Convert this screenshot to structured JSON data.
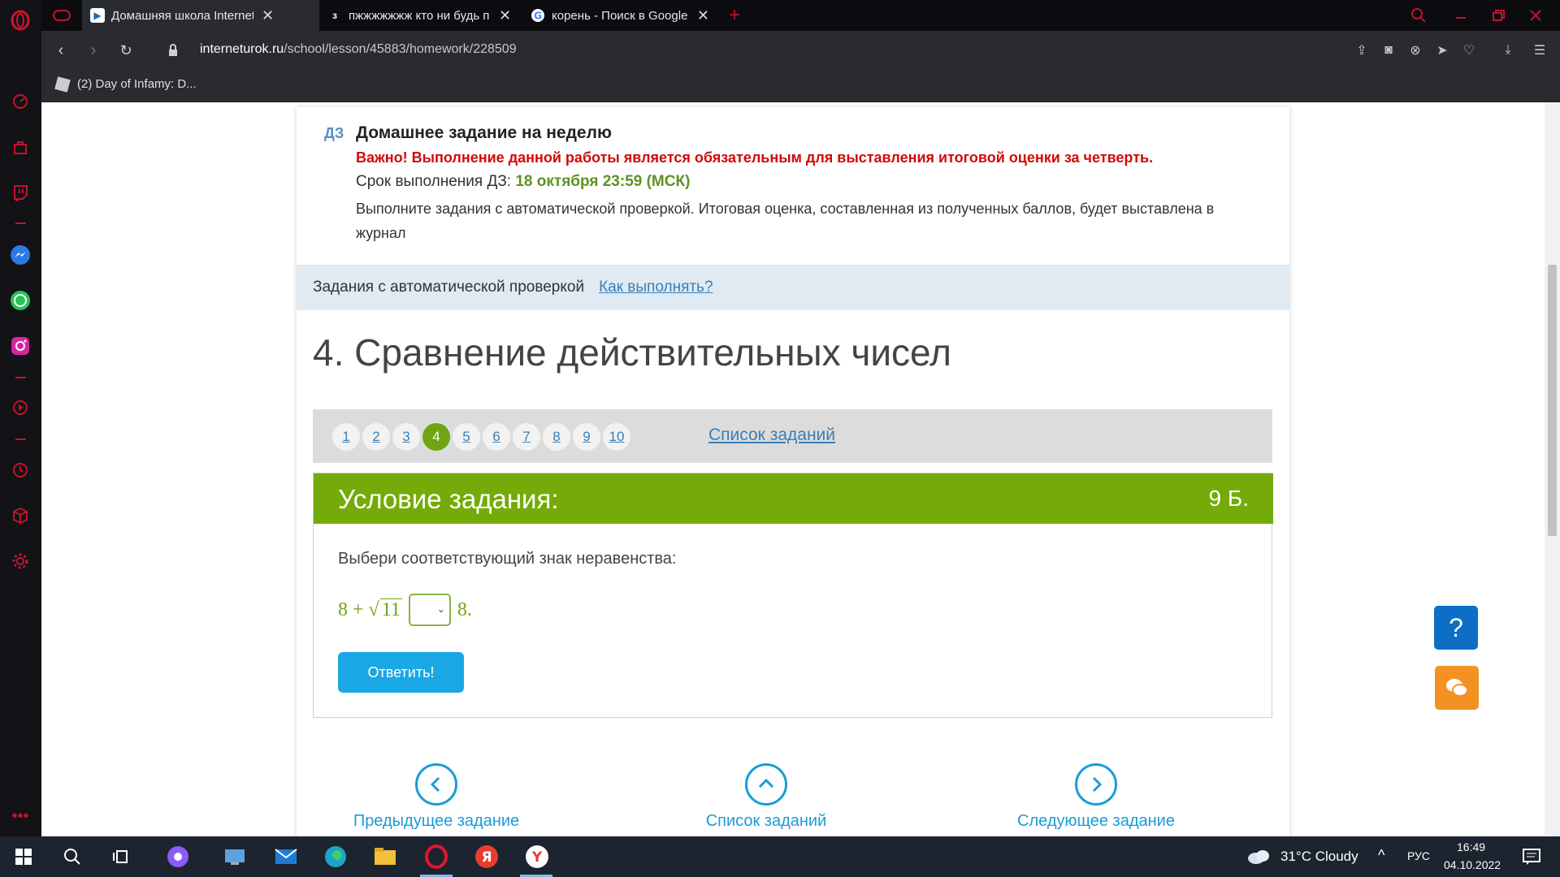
{
  "browser": {
    "tabs": [
      {
        "title": "Домашняя школа Internet",
        "favicon": "interneturok-favicon"
      },
      {
        "title": "пжжжжжжж кто ни будь п",
        "favicon": "znanija-favicon",
        "favicon_letter": "з"
      },
      {
        "title": "корень - Поиск в Google",
        "favicon": "google-favicon"
      }
    ],
    "new_tab": "+",
    "url_host": "interneturok.ru",
    "url_path": "/school/lesson/45883/homework/228509",
    "bookmark": "(2) Day of Infamy: D..."
  },
  "homework": {
    "tag": "ДЗ",
    "title": "Домашнее задание на неделю",
    "important": "Важно! Выполнение данной работы является обязательным для выставления итоговой оценки за четверть.",
    "deadline_label": "Срок выполнения ДЗ: ",
    "deadline_value": "18 октября 23:59 (МСК)",
    "description": "Выполните задания с автоматической проверкой. Итоговая оценка, составленная из полученных баллов, будет выставлена в журнал"
  },
  "auto_check": {
    "label": "Задания с автоматической проверкой",
    "how_link": "Как выполнять?"
  },
  "task": {
    "heading": "4. Сравнение действительных чисел",
    "pages": [
      "1",
      "2",
      "3",
      "4",
      "5",
      "6",
      "7",
      "8",
      "9",
      "10"
    ],
    "active_page": "4",
    "list_link": "Список заданий",
    "condition_title": "Условие задания:",
    "points": "9 Б.",
    "question": "Выбери соответствующий знак неравенства:",
    "math_left": "8 + √",
    "math_radicand": "11",
    "math_right": "8.",
    "select_value": "",
    "submit_label": "Ответить!"
  },
  "nav": {
    "prev": "Предыдущее задание",
    "list": "Список заданий",
    "next": "Следующее задание"
  },
  "help_label": "?",
  "taskbar": {
    "weather": "31°C  Cloudy",
    "lang": "РУС",
    "time": "16:49",
    "date": "04.10.2022"
  },
  "colors": {
    "accent_green": "#74ab08",
    "link_blue": "#3a7fb6",
    "warn_red": "#d10a0a",
    "button_blue": "#1aa7e5"
  }
}
